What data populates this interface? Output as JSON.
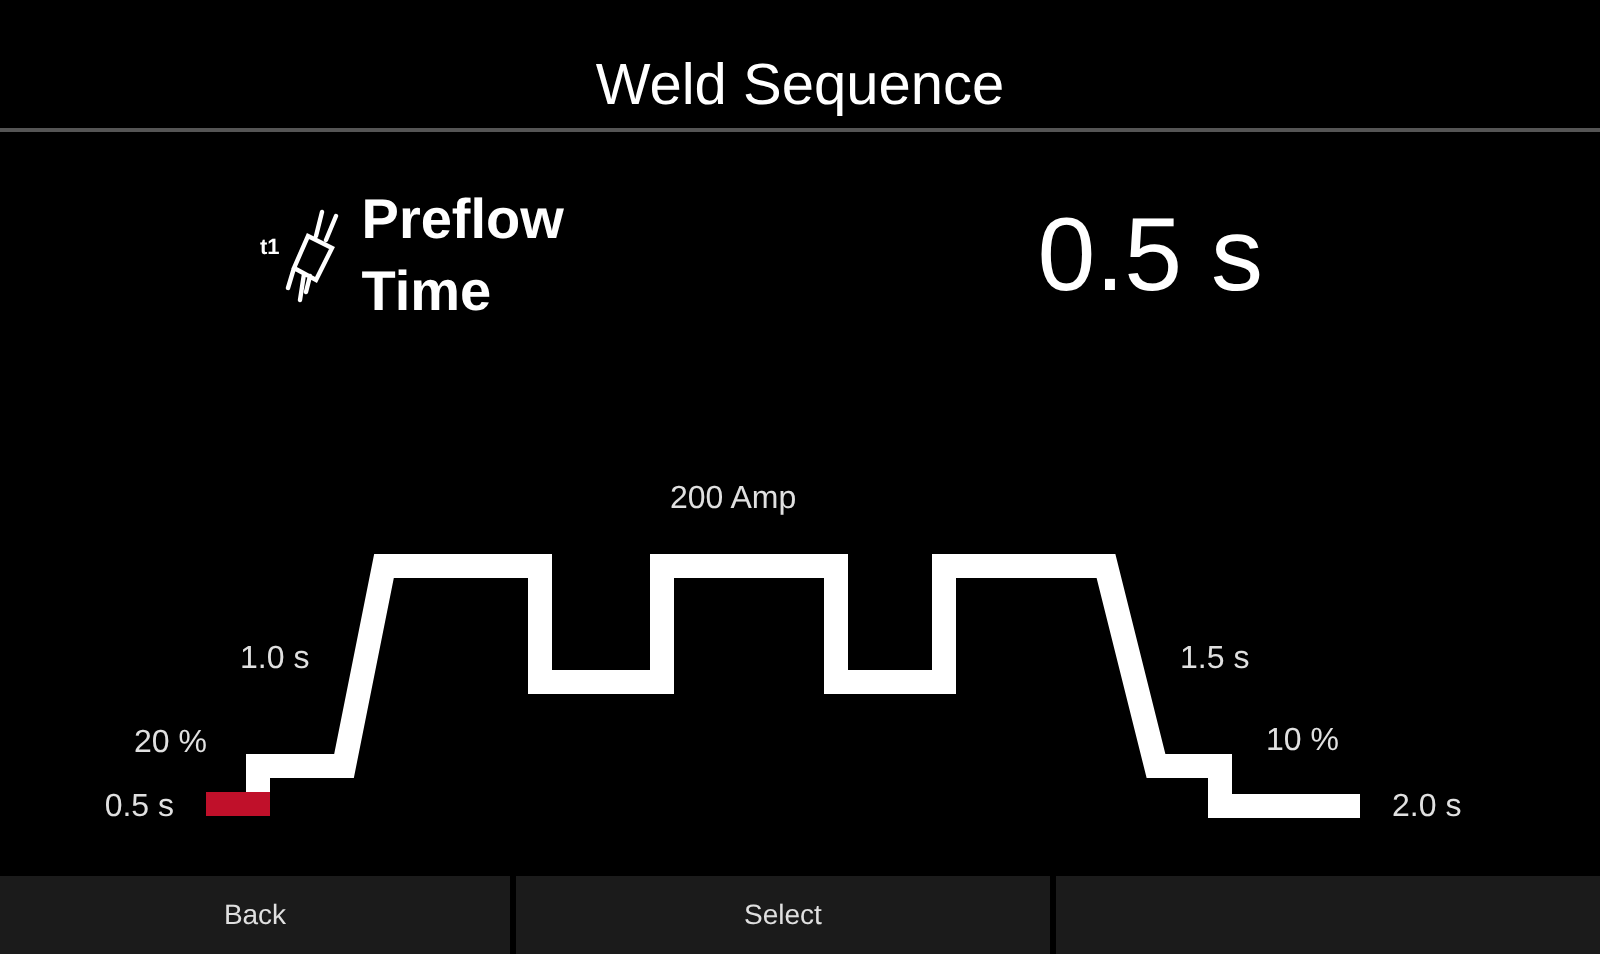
{
  "header": {
    "title": "Weld Sequence"
  },
  "parameter": {
    "icon_label": "t1",
    "name": "Preflow Time",
    "value": "0.5 s"
  },
  "phases": [
    {
      "label": "0.5 s",
      "selected": true
    },
    {
      "label": "20 %",
      "selected": false
    },
    {
      "label": "1.0 s",
      "selected": false
    },
    {
      "label": "200 Amp",
      "selected": false
    },
    {
      "label": "1.5 s",
      "selected": false
    },
    {
      "label": "10 %",
      "selected": false
    },
    {
      "label": "2.0 s",
      "selected": false
    }
  ],
  "buttons": [
    "Back",
    "Select"
  ]
}
